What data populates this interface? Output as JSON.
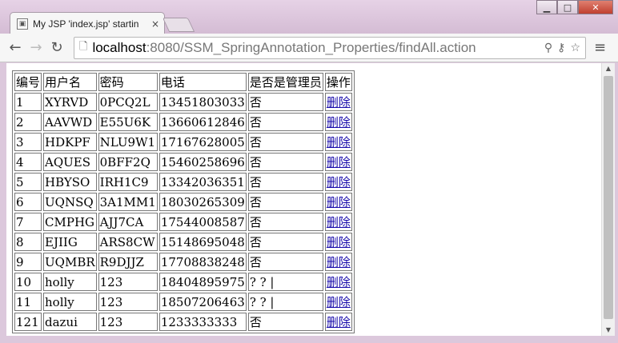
{
  "browser": {
    "tab_title": "My JSP 'index.jsp' startin",
    "tab_close": "×",
    "url_host": "localhost",
    "url_rest": ":8080/SSM_SpringAnnotation_Properties/findAll.action"
  },
  "icons": {
    "back": "←",
    "forward": "→",
    "reload": "↻",
    "page": "🗋",
    "zoom": "⚲",
    "key": "⚷",
    "star": "☆",
    "menu": "≡",
    "minimize": "▁",
    "maximize": "□",
    "close": "✕"
  },
  "table": {
    "headers": [
      "编号",
      "用户名",
      "密码",
      "电话",
      "是否是管理员",
      "操作"
    ],
    "rows": [
      [
        "1",
        "XYRVD",
        "0PCQ2L",
        "13451803033",
        "否",
        "删除"
      ],
      [
        "2",
        "AAVWD",
        "E55U6K",
        "13660612846",
        "否",
        "删除"
      ],
      [
        "3",
        "HDKPF",
        "NLU9W1",
        "17167628005",
        "否",
        "删除"
      ],
      [
        "4",
        "AQUES",
        "0BFF2Q",
        "15460258696",
        "否",
        "删除"
      ],
      [
        "5",
        "HBYSO",
        "IRH1C9",
        "13342036351",
        "否",
        "删除"
      ],
      [
        "6",
        "UQNSQ",
        "3A1MM1",
        "18030265309",
        "否",
        "删除"
      ],
      [
        "7",
        "CMPHG",
        "AJJ7CA",
        "17544008587",
        "否",
        "删除"
      ],
      [
        "8",
        "EJIIG",
        "ARS8CW",
        "15148695048",
        "否",
        "删除"
      ],
      [
        "9",
        "UQMBR",
        "R9DJJZ",
        "17708838248",
        "否",
        "删除"
      ],
      [
        "10",
        "holly",
        "123",
        "18404895975",
        "? ? |",
        "删除"
      ],
      [
        "11",
        "holly",
        "123",
        "18507206463",
        "? ? |",
        "删除"
      ],
      [
        "121",
        "dazui",
        "123",
        "1233333333",
        "否",
        "删除"
      ]
    ]
  }
}
